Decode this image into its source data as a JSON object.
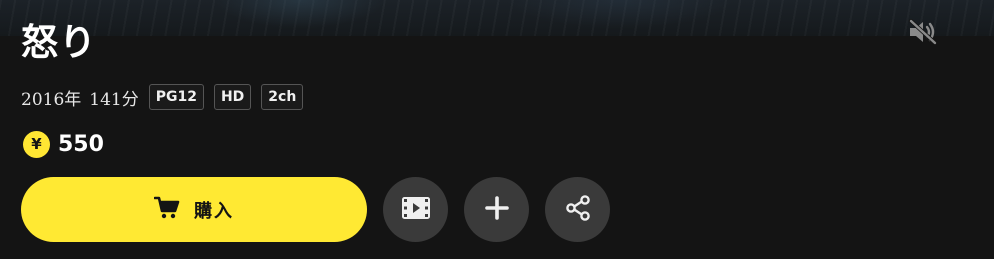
{
  "title": "怒り",
  "meta": {
    "year": "2016年",
    "duration": "141分",
    "badges": [
      "PG12",
      "HD",
      "2ch"
    ]
  },
  "price": {
    "currency_symbol": "¥",
    "value": "550"
  },
  "actions": {
    "buy_label": "購入",
    "trailer_icon": "film-play-icon",
    "add_icon": "plus-icon",
    "share_icon": "share-icon"
  },
  "controls": {
    "mute_icon": "speaker-muted-icon"
  },
  "colors": {
    "background": "#141414",
    "accent": "#ffe933",
    "circle_button": "#3a3a3a"
  }
}
